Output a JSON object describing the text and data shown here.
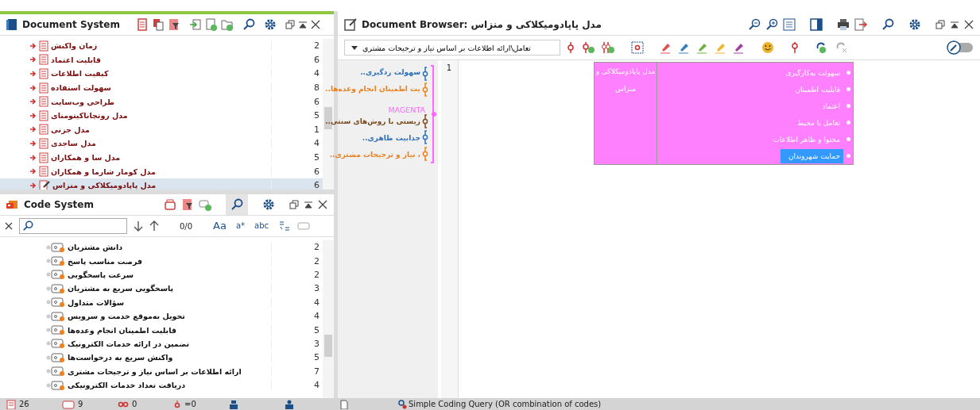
{
  "document_system": {
    "title": "Document System",
    "items": [
      {
        "name": "زمان واکنش",
        "count": "2",
        "selected": false
      },
      {
        "name": "قابلیت اعتماد",
        "count": "6",
        "selected": false
      },
      {
        "name": "کیفیت اطلاعات",
        "count": "4",
        "selected": false
      },
      {
        "name": "سهولت استفاده",
        "count": "8",
        "selected": false
      },
      {
        "name": "طراحی وب‌سایت",
        "count": "6",
        "selected": false
      },
      {
        "name": "مدل روتچاناکیتومنای",
        "count": "5",
        "selected": false
      },
      {
        "name": "مدل جزنی",
        "count": "1",
        "selected": false
      },
      {
        "name": "مدل ساجدی",
        "count": "4",
        "selected": false
      },
      {
        "name": "مدل سا و همکاران",
        "count": "5",
        "selected": false
      },
      {
        "name": "مدل کومار شارما و همکاران",
        "count": "6",
        "selected": false
      },
      {
        "name": "مدل پاپادومیکلاکی و منزاس",
        "count": "6",
        "selected": true
      }
    ]
  },
  "code_system": {
    "title": "Code System",
    "search": {
      "counter": "0/0",
      "match_case": "Aa",
      "wildcard": "a*",
      "whole_word": "abc"
    },
    "items": [
      {
        "name": "دانش مشتریان",
        "count": "2"
      },
      {
        "name": "فرصت مناسب پاسخ",
        "count": "2"
      },
      {
        "name": "سرعت پاسخگویی",
        "count": "2"
      },
      {
        "name": "پاسخگویی سریع به مشتریان",
        "count": "3"
      },
      {
        "name": "سؤالات متداول",
        "count": "4"
      },
      {
        "name": "تحویل به‌موقع خدمت و سرویس",
        "count": "4"
      },
      {
        "name": "قابلیت اطمینان انجام وعده‌ها",
        "count": "5"
      },
      {
        "name": "تضمین در ارائه خدمات الکترونیک",
        "count": "3"
      },
      {
        "name": "واکنش سریع به درخواست‌ها",
        "count": "5"
      },
      {
        "name": "ارائه اطلاعات بر اساس نیاز و ترجیحات مشتری",
        "count": "7"
      },
      {
        "name": "دریافت تعداد خدمات الکترونیکی",
        "count": "4"
      }
    ]
  },
  "status_bar": {
    "documents": "26",
    "codes": "9",
    "segments": "0",
    "weighted": "=0",
    "query": "Simple Coding Query (OR combination of codes)"
  },
  "document_browser": {
    "title_prefix": "Document Browser: ",
    "document": "مدل پاپادومیکلاکی و منزاس",
    "code_dropdown": "تعامل\\ارائه اطلاعات بر اساس نیاز و ترجیحات مشتری",
    "stripes": [
      {
        "label": "سهولت ردگیری..",
        "color": "#2e6fb5"
      },
      {
        "label": "یت اطمینان انجام وعده‌ها..",
        "color": "#e8801e"
      },
      {
        "label": "زیستی با روش‌های سنتی..",
        "color": "#7a4a1e"
      },
      {
        "label": "جذابیت ظاهری..",
        "color": "#2e6fb5"
      },
      {
        "label": "، نیاز و ترجیحات مشتری..",
        "color": "#e8801e"
      }
    ],
    "bracket": {
      "label": "MAGENTA",
      "color": "#ff66ff"
    },
    "line_number": "1",
    "table": {
      "left_cell": "مدل پاپادومیکلاکی و منزاس",
      "items": [
        {
          "text": "سهولت به‌کارگیری",
          "selected": false
        },
        {
          "text": "قابلیت اطمینان",
          "selected": false
        },
        {
          "text": "اعتماد",
          "selected": false
        },
        {
          "text": "تعامل با محیط",
          "selected": false
        },
        {
          "text": "محتوا و ظاهر اطلاعات",
          "selected": false
        },
        {
          "text": "حمایت شهروندان",
          "selected": true
        }
      ]
    }
  }
}
